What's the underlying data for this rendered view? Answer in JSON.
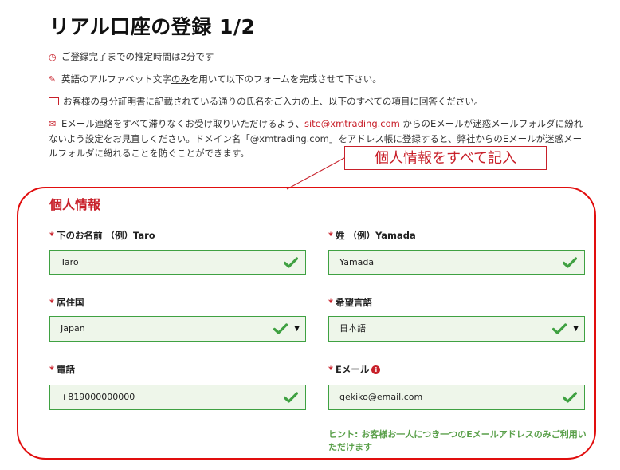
{
  "page": {
    "title": "リアル口座の登録 1/2"
  },
  "notices": {
    "time": "ご登録完了までの推定時間は2分です",
    "alphabet_before": "英語のアルファベット文字",
    "alphabet_underline": "のみ",
    "alphabet_after": "を用いて以下のフォームを完成させて下さい。",
    "id_doc": "お客様の身分証明書に記載されている通りの氏名をご入力の上、以下のすべての項目に回答ください。",
    "mail_before": "Eメール連絡をすべて滞りなくお受け取りいただけるよう、",
    "mail_address": "site@xmtrading.com",
    "mail_after": " からのEメールが迷惑メールフォルダに紛れないよう設定をお見直しください。ドメイン名「@xmtrading.com」をアドレス帳に登録すると、弊社からのEメールが迷惑メールフォルダに紛れることを防ぐことができます。"
  },
  "callout": {
    "text": "個人情報をすべて記入"
  },
  "form": {
    "section_title": "個人情報",
    "required_mark": "*",
    "first_name": {
      "label": "下のお名前 （例）Taro",
      "value": "Taro"
    },
    "last_name": {
      "label": "姓 （例）Yamada",
      "value": "Yamada"
    },
    "country": {
      "label": "居住国",
      "value": "Japan"
    },
    "language": {
      "label": "希望言語",
      "value": "日本語"
    },
    "phone": {
      "label": "電話",
      "value": "+819000000000"
    },
    "email": {
      "label": "Eメール",
      "value": "gekiko@email.com",
      "hint": "ヒント: お客様お一人につき一つのEメールアドレスのみご利用いただけます"
    }
  },
  "icons": {
    "clock": "clock-icon",
    "pencil": "pencil-icon",
    "id_card": "id-card-icon",
    "mail": "mail-icon",
    "check": "check-icon",
    "info": "info-icon",
    "caret": "caret-down-icon"
  },
  "colors": {
    "accent_red": "#c8202a",
    "valid_green": "#3fa142",
    "valid_bg": "#eef6ea",
    "highlight_red": "#e10e0e",
    "hint_green": "#5aa04a"
  }
}
